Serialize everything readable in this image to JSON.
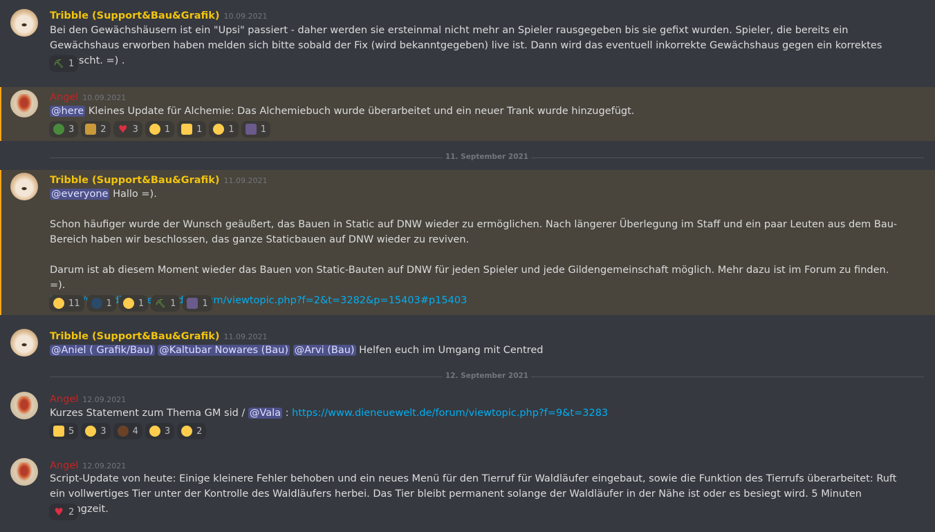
{
  "messages": [
    {
      "author": "Tribble (Support&Bau&Grafik)",
      "time": "10.09.2021",
      "text": "Bei den Gewächshäusern ist ein \"Upsi\" passiert - daher werden sie ersteinmal nicht mehr an Spieler rausgegeben bis sie gefixt wurden. Spieler, die bereits ein Gewächshaus erworben haben melden sich bitte sobald der Fix (wird bekanntgegeben) live ist. Dann wird das eventuell inkorrekte Gewächshaus gegen ein korrektes getauscht. =) .",
      "reactions": [
        {
          "icon": "pickaxe-icon",
          "count": "1"
        }
      ]
    },
    {
      "author": "Angel",
      "time": "10.09.2021",
      "mention": "@here",
      "text": "Kleines Update für Alchemie: Das Alchemiebuch wurde überarbeitet und ein neuer Trank wurde hinzugefügt.",
      "reactions": [
        {
          "icon": "frog-icon",
          "count": "3"
        },
        {
          "icon": "beer-icon",
          "count": "2"
        },
        {
          "icon": "heart-icon",
          "count": "3"
        },
        {
          "icon": "monocle-face-icon",
          "count": "1"
        },
        {
          "icon": "thumbs-up-icon",
          "count": "1"
        },
        {
          "icon": "hugging-face-icon",
          "count": "1"
        },
        {
          "icon": "triangle-icon",
          "count": "1"
        }
      ]
    },
    {
      "author": "Tribble (Support&Bau&Grafik)",
      "time": "11.09.2021",
      "mention": "@everyone",
      "greeting": "Hallo =).",
      "para1": "Schon häufiger wurde der Wunsch geäußert, das Bauen in Static auf DNW wieder zu ermöglichen. Nach längerer Überlegung im Staff und ein paar Leuten aus dem Bau-Bereich haben wir beschlossen, das ganze Staticbauen auf DNW wieder zu reviven.",
      "para2": "Darum ist ab diesem Moment wieder das Bauen von Static-Bauten auf DNW für jeden Spieler und jede Gildengemeinschaft möglich. Mehr dazu ist im Forum zu finden. =).",
      "link": "https://www.dieneuewelt.de/forum/viewtopic.php?f=2&t=3282&p=15403#p15403",
      "reactions": [
        {
          "icon": "smiling-hearts-icon",
          "count": "11"
        },
        {
          "icon": "eyes-icon",
          "count": "1"
        },
        {
          "icon": "hugging-face-icon",
          "count": "1"
        },
        {
          "icon": "pickaxe-icon",
          "count": "1"
        },
        {
          "icon": "triangle-icon",
          "count": "1"
        }
      ]
    },
    {
      "author": "Tribble (Support&Bau&Grafik)",
      "time": "11.09.2021",
      "mentions": [
        "@Aniel ( Grafik/Bau)",
        "@Kaltubar Nowares (Bau)",
        "@Arvi (Bau)"
      ],
      "text": " Helfen euch im Umgang mit Centred"
    },
    {
      "author": "Angel",
      "time": "12.09.2021",
      "text_before": "Kurzes Statement zum Thema GM sid /",
      "mention": "@Vala",
      "separator": " : ",
      "link": "https://www.dieneuewelt.de/forum/viewtopic.php?f=9&t=3283",
      "reactions": [
        {
          "icon": "thumbs-up-icon",
          "count": "5"
        },
        {
          "icon": "rolling-eyes-icon",
          "count": "3"
        },
        {
          "icon": "poop-icon",
          "count": "4"
        },
        {
          "icon": "joy-icon",
          "count": "3"
        },
        {
          "icon": "mind-blown-icon",
          "count": "2"
        }
      ]
    },
    {
      "author": "Angel",
      "time": "12.09.2021",
      "text": "Script-Update von heute: Einige kleinere Fehler behoben und ein neues Menü für den Tierruf für Waldläufer eingebaut, sowie die Funktion des Tierrufs überarbeitet: Ruft ein vollwertiges Tier unter der Kontrolle des Waldläufers herbei. Das Tier bleibt permanent solange der Waldläufer in der Nähe ist oder es besiegt wird. 5 Minuten Abklingzeit.",
      "reactions": [
        {
          "icon": "heart-icon",
          "count": "2"
        }
      ]
    }
  ],
  "dividers": [
    "11. September 2021",
    "12. September 2021"
  ],
  "colors": {
    "background": "#36393f",
    "highlight": "#49443c",
    "gold": "#f1c40f",
    "red": "#c22626",
    "mention": "#4d518a",
    "link": "#00aff4"
  }
}
